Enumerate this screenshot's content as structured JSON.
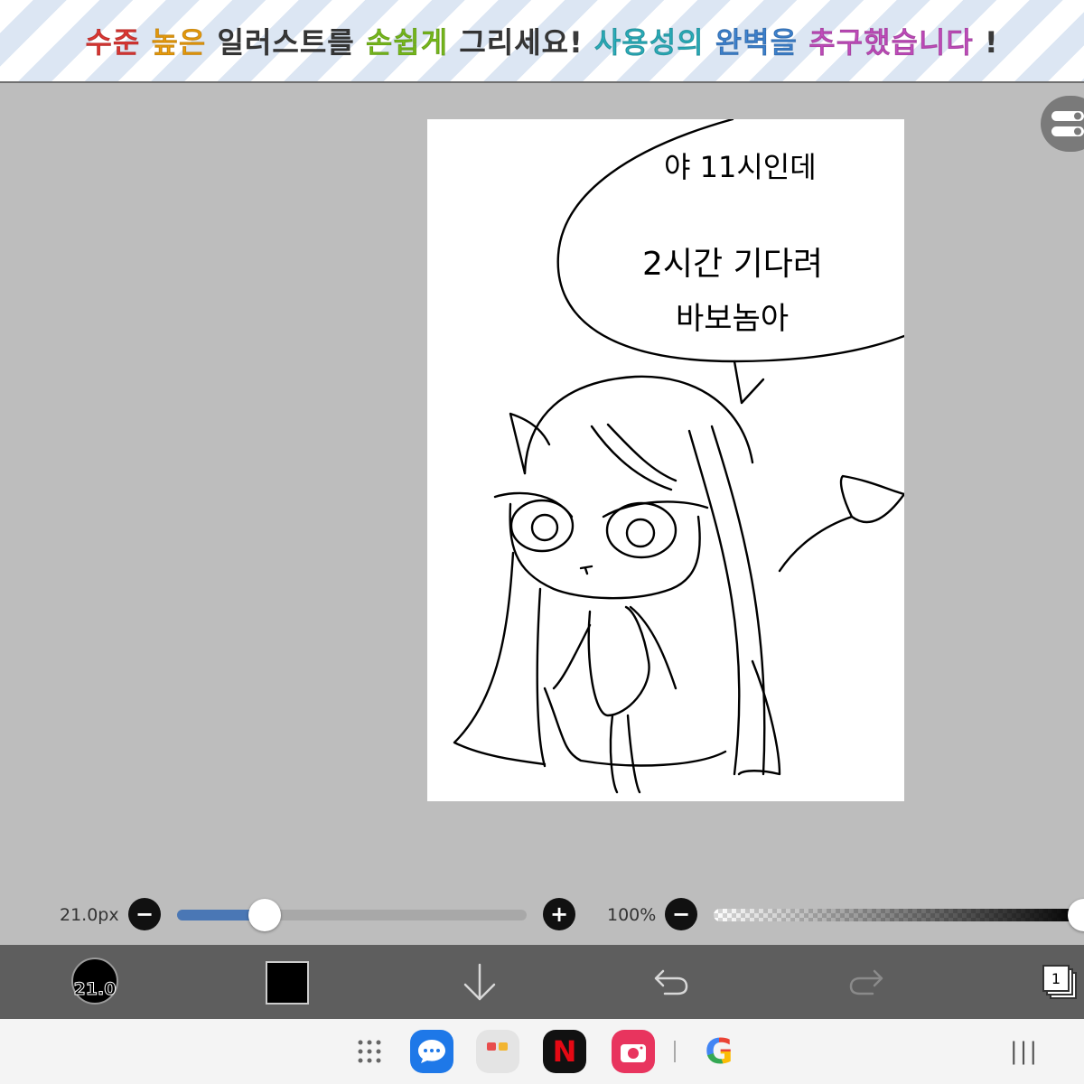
{
  "banner": {
    "segments": [
      {
        "text": "수준 ",
        "color": "#e53935"
      },
      {
        "text": "높은 ",
        "color": "#f2a20c"
      },
      {
        "text": "일러스트를 ",
        "color": "#3a3a3a"
      },
      {
        "text": "손쉽게 ",
        "color": "#7cc21d"
      },
      {
        "text": "그리세요! ",
        "color": "#3a3a3a"
      },
      {
        "text": "사용성의 ",
        "color": "#2bb3c0"
      },
      {
        "text": "완벽을 ",
        "color": "#3f86d6"
      },
      {
        "text": "추구했습니다",
        "color": "#c94fc4"
      },
      {
        "text": " !",
        "color": "#3a3a3a"
      }
    ]
  },
  "canvas": {
    "speech_line1": "야 11시인데",
    "speech_line2": "2시간 기다려",
    "speech_line3": "바보놈아"
  },
  "slider_row": {
    "brush_size_label": "21.0px",
    "brush_size_fraction": 0.25,
    "opacity_label": "100%",
    "opacity_fraction": 1.0,
    "minus_symbol": "−",
    "plus_symbol": "+"
  },
  "toolbar": {
    "brush_size_value": "21.0",
    "current_color": "#000000",
    "layer_count": "1",
    "icons": [
      "brush-size-icon",
      "color-swatch",
      "download-arrow-icon",
      "undo-icon",
      "redo-icon",
      "layers-icon"
    ]
  },
  "navbar": {
    "apps": [
      "app-drawer-icon",
      "messages-app-icon",
      "folder-app-icon",
      "netflix-app-icon",
      "camera-app-icon",
      "google-app-icon"
    ],
    "netflix_letter": "N",
    "google_letter": "G",
    "recents_glyph": "|||"
  }
}
